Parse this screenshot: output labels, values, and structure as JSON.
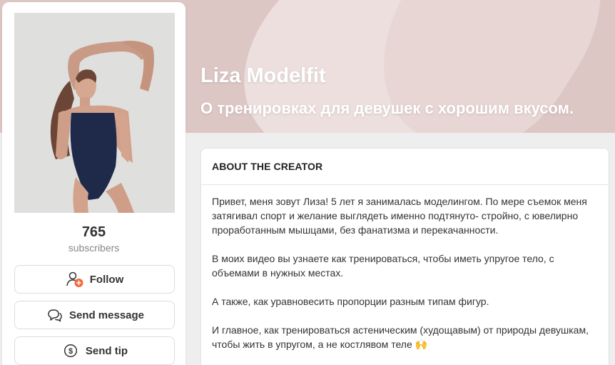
{
  "creator": {
    "name": "Liza Modelfit",
    "tagline": "О тренировках для девушек с хорошим вкусом."
  },
  "stats": {
    "subscribers_count": "765",
    "subscribers_label": "subscribers"
  },
  "actions": {
    "follow_label": "Follow",
    "message_label": "Send message",
    "tip_label": "Send tip"
  },
  "about": {
    "title": "ABOUT THE CREATOR",
    "paragraphs": [
      "Привет, меня зовут Лиза! 5 лет я занималась моделингом. По мере съемок меня затягивал спорт и желание выглядеть именно подтянуто- стройно, с ювелирно проработанным мышцами, без фанатизма и перекачанности.",
      "В моих видео вы узнаете как тренироваться, чтобы иметь упругое тело, с объемами в нужных местах.",
      "А также, как уравновесить пропорции разным типам фигур.",
      "И главное, как тренироваться астеническим (худощавым) от природы девушкам, чтобы жить в упругом, а не костлявом теле 🙌"
    ]
  },
  "icons": {
    "follow": "user-plus-icon",
    "message": "chat-bubbles-icon",
    "tip": "dollar-coin-icon"
  },
  "colors": {
    "accent": "#f26a3d",
    "cover": "#dcc7c5",
    "page_background": "#eeeeee"
  }
}
